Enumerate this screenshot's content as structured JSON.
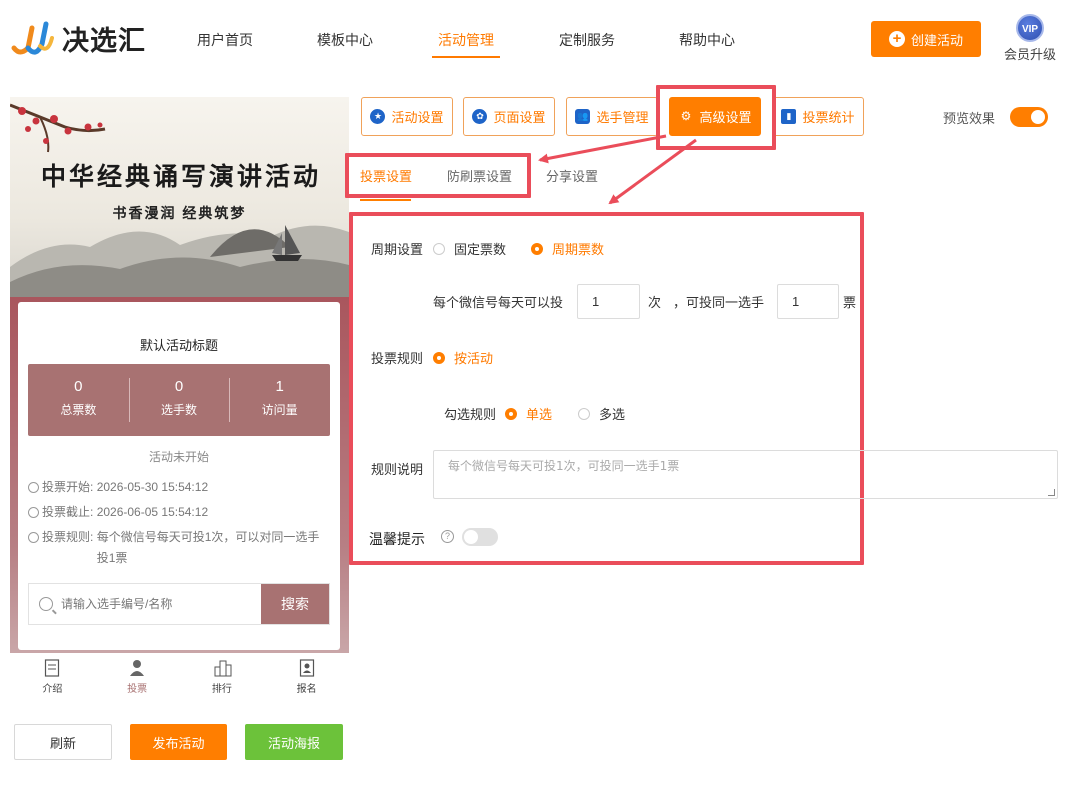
{
  "header": {
    "logo_text": "决选汇",
    "nav": [
      "用户首页",
      "模板中心",
      "活动管理",
      "定制服务",
      "帮助中心"
    ],
    "active_nav": "活动管理",
    "create_button": "创建活动",
    "vip_badge": "VIP",
    "vip_label": "会员升级"
  },
  "preview": {
    "banner_title": "中华经典诵写演讲活动",
    "banner_subtitle": "书香漫润  经典筑梦",
    "card_title": "默认活动标题",
    "stats": [
      {
        "value": "0",
        "label": "总票数"
      },
      {
        "value": "0",
        "label": "选手数"
      },
      {
        "value": "1",
        "label": "访问量"
      }
    ],
    "status": "活动未开始",
    "vote_start_label": "投票开始:",
    "vote_start": "2026-05-30 15:54:12",
    "vote_end_label": "投票截止:",
    "vote_end": "2026-06-05 15:54:12",
    "vote_rule_label": "投票规则:",
    "vote_rule": "每个微信号每天可投1次，可以对同一选手投1票",
    "search_placeholder": "请输入选手编号/名称",
    "search_button": "搜索",
    "tabbar": [
      "介绍",
      "投票",
      "排行",
      "报名"
    ]
  },
  "actions": {
    "refresh": "刷新",
    "publish": "发布活动",
    "poster": "活动海报"
  },
  "settings": {
    "tabs": [
      "活动设置",
      "页面设置",
      "选手管理",
      "高级设置",
      "投票统计"
    ],
    "active_tab": "高级设置",
    "preview_label": "预览效果",
    "subtabs": [
      "投票设置",
      "防刷票设置",
      "分享设置"
    ],
    "active_subtab": "投票设置",
    "cycle_label": "周期设置",
    "cycle_options": [
      "固定票数",
      "周期票数"
    ],
    "cycle_selected": "周期票数",
    "per_day_prefix": "每个微信号每天可以投",
    "per_day_value": "1",
    "per_day_unit": "次",
    "same_player_prefix": "，可投同一选手",
    "same_player_value": "1",
    "same_player_unit": "票",
    "rule_label": "投票规则",
    "rule_option": "按活动",
    "check_label": "勾选规则",
    "check_options": [
      "单选",
      "多选"
    ],
    "check_selected": "单选",
    "desc_label": "规则说明",
    "desc_placeholder": "每个微信号每天可投1次，可投同一选手1票",
    "tip_label": "温馨提示",
    "colors": {
      "accent": "#ff7e00",
      "highlight": "#ea4d5a",
      "theme": "#a87272",
      "green": "#6cc23a"
    }
  }
}
